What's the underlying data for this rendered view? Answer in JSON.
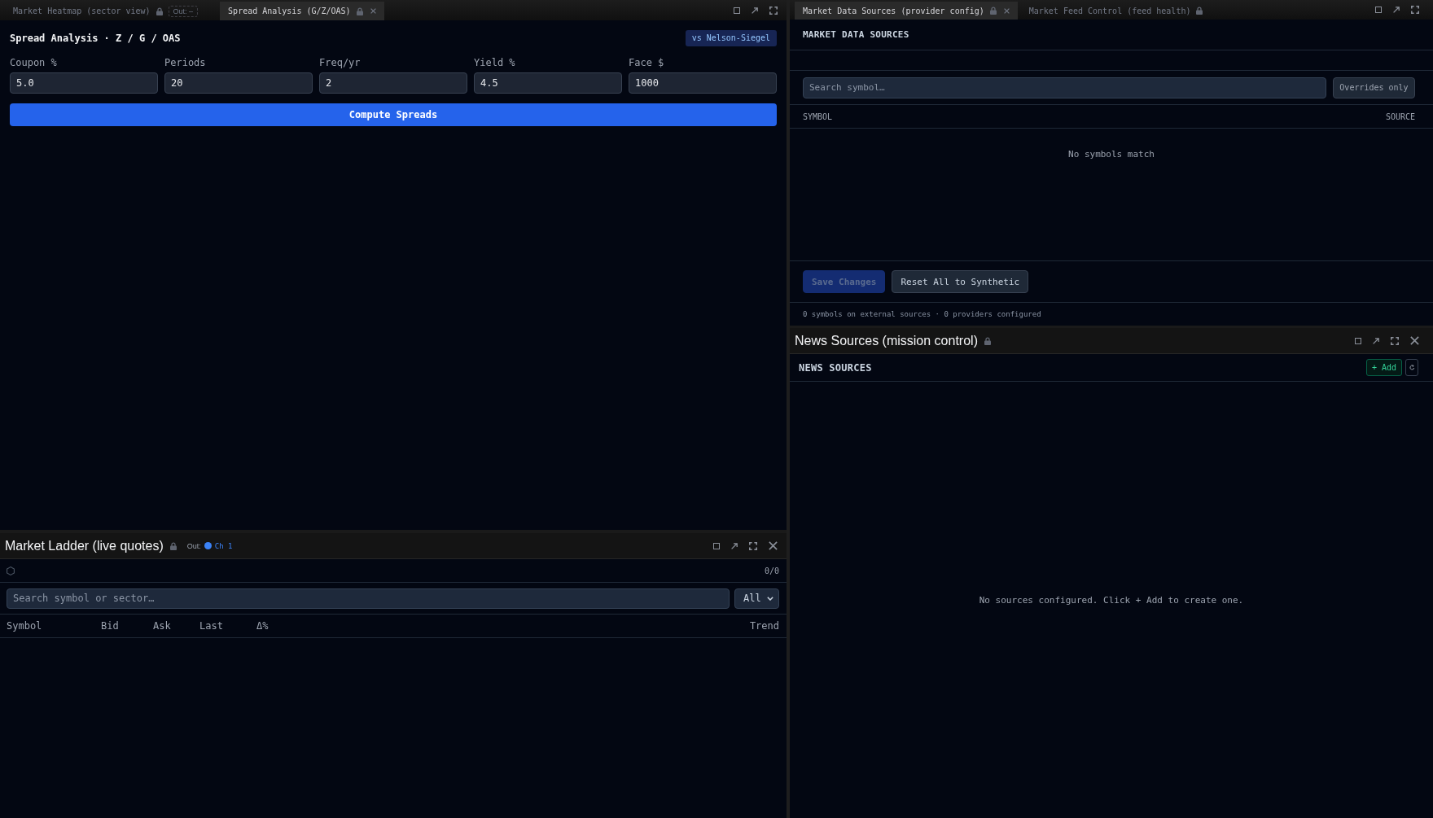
{
  "spread_pane": {
    "tabs": [
      {
        "label": "Market Heatmap (sector view)",
        "selected": false,
        "locked": true,
        "output": {
          "label": "Out:",
          "channel": "–",
          "linked": false
        }
      },
      {
        "label": "Spread Analysis (G/Z/OAS)",
        "selected": true,
        "locked": true
      }
    ],
    "title": "Spread Analysis · Z / G / OAS",
    "badge": "vs Nelson-Siegel",
    "fields": [
      {
        "label": "Coupon %",
        "value": "5.0"
      },
      {
        "label": "Periods",
        "value": "20"
      },
      {
        "label": "Freq/yr",
        "value": "2"
      },
      {
        "label": "Yield %",
        "value": "4.5"
      },
      {
        "label": "Face $",
        "value": "1000"
      }
    ],
    "compute_button": "Compute Spreads"
  },
  "ladder_pane": {
    "title": "Market Ladder (live quotes)",
    "locked": true,
    "output": {
      "label": "Out:",
      "channel": "Ch 1",
      "linked": true
    },
    "count": "0/0",
    "search": {
      "placeholder": "Search symbol or sector…"
    },
    "filter": {
      "value": "All"
    },
    "columns": [
      "Symbol",
      "Bid",
      "Ask",
      "Last",
      "Δ%",
      "Trend"
    ]
  },
  "data_sources_pane": {
    "tabs": [
      {
        "label": "Market Data Sources (provider config)",
        "selected": true,
        "locked": true
      },
      {
        "label": "Market Feed Control (feed health)",
        "selected": false,
        "locked": true
      }
    ],
    "heading": "MARKET DATA SOURCES",
    "search": {
      "placeholder": "Search symbol…"
    },
    "filter_button": "Overrides only",
    "columns": [
      "SYMBOL",
      "SOURCE"
    ],
    "empty_message": "No symbols match",
    "buttons": [
      {
        "label": "Save Changes",
        "kind": "primary",
        "disabled": true
      },
      {
        "label": "Reset All to Synthetic",
        "kind": "secondary",
        "disabled": false
      }
    ],
    "footer": "0 symbols on external sources · 0 providers configured"
  },
  "news_pane": {
    "title": "News Sources (mission control)",
    "locked": true,
    "heading": "NEWS SOURCES",
    "add_button": "+ Add",
    "empty_message": "No sources configured. Click + Add to create one."
  }
}
